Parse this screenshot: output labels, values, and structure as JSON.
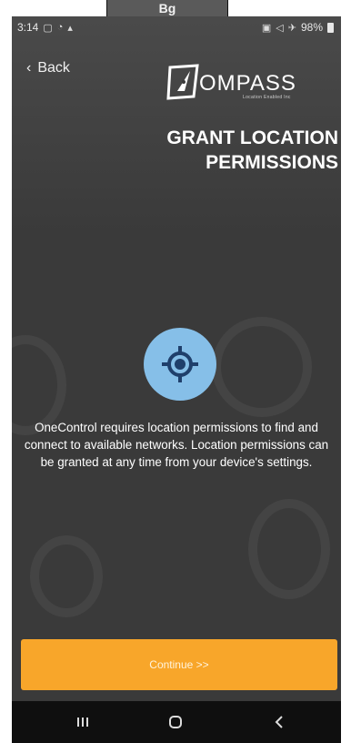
{
  "tab_label": "Bg",
  "status": {
    "time": "3:14",
    "left_icons": [
      "gallery-icon",
      "wifi-icon",
      "signal-icon"
    ],
    "right_icons": [
      "vibrate-icon",
      "mute-icon",
      "airplane-icon"
    ],
    "battery": "98%"
  },
  "header": {
    "back_label": "Back",
    "logo_text": "OMPASS",
    "logo_subtext": "Location Enabled Inc",
    "title_line1": "GRANT LOCATION",
    "title_line2": "PERMISSIONS"
  },
  "main": {
    "icon": "location-crosshair-icon",
    "message": "OneControl requires location permissions to find and connect to available networks. Location permissions can be granted at any time from your device's settings."
  },
  "footer": {
    "continue_label": "Continue >>"
  },
  "navbar": {
    "buttons": [
      "recents-icon",
      "home-icon",
      "back-icon"
    ]
  },
  "colors": {
    "accent": "#f8a62a",
    "icon_circle": "#86bfe8",
    "icon_dark": "#1f3f6b",
    "background": "#3a3a3a"
  }
}
